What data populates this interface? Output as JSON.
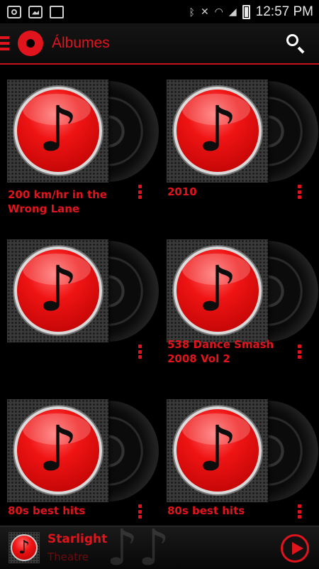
{
  "status_bar": {
    "left_icons": [
      "target-icon",
      "photo-icon",
      "briefcase-icon"
    ],
    "right_icons": [
      "bluetooth-icon",
      "mute-icon",
      "wifi-icon",
      "signal-icon",
      "battery-icon"
    ],
    "time": "12:57 PM"
  },
  "action_bar": {
    "title": "Álbumes"
  },
  "albums": [
    {
      "title": "200 km/hr in the Wrong Lane"
    },
    {
      "title": "2010"
    },
    {
      "title": ""
    },
    {
      "title": "538 Dance Smash 2008 Vol 2"
    },
    {
      "title": "80s best hits"
    },
    {
      "title": "80s best hits"
    }
  ],
  "now_playing": {
    "title": "Starlight",
    "artist": "Theatre"
  },
  "colors": {
    "accent": "#e0141c",
    "background": "#000000"
  }
}
